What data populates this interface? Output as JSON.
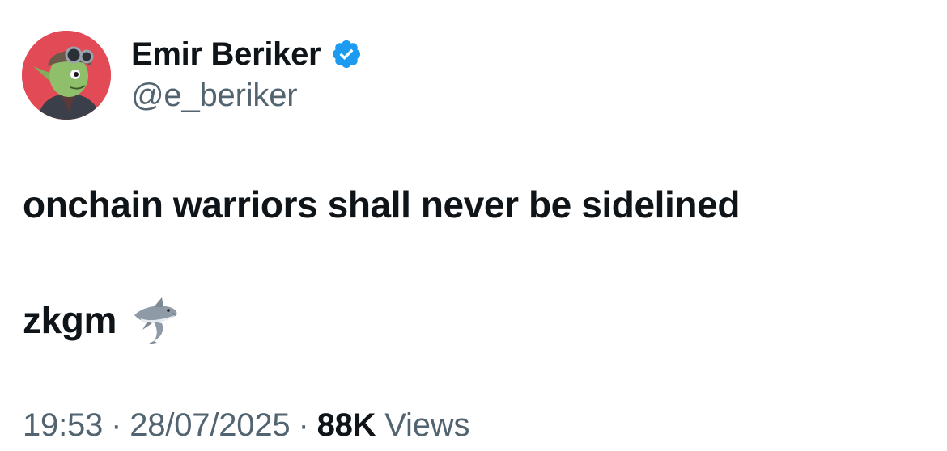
{
  "author": {
    "display_name": "Emir Beriker",
    "handle": "@e_beriker",
    "verified_icon": "verified-badge-icon",
    "avatar_icon": "goblin-aviator-avatar"
  },
  "tweet": {
    "line1": "onchain warriors shall never be sidelined",
    "line2": "zkgm",
    "emoji": "shark-icon"
  },
  "meta": {
    "time": "19:53",
    "separator": "·",
    "date": "28/07/2025",
    "views_count": "88K",
    "views_label": "Views"
  },
  "colors": {
    "text": "#0f1419",
    "secondary": "#536471",
    "verified": "#1d9bf0",
    "avatar_bg": "#e24a56"
  }
}
